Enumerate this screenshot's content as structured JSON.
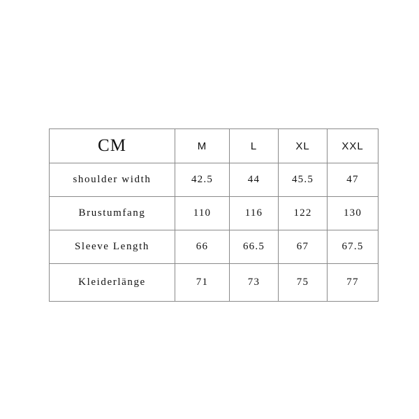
{
  "page": {
    "background_color": "#ffffff",
    "border_color": "#8a8a8a",
    "text_color": "#111111"
  },
  "chart_data": {
    "type": "table",
    "title": "",
    "unit_label": "CM",
    "columns": [
      "CM",
      "M",
      "L",
      "XL",
      "XXL"
    ],
    "size_headers": [
      "M",
      "L",
      "XL",
      "XXL"
    ],
    "rows": [
      {
        "label": "shoulder width",
        "values": [
          "42.5",
          "44",
          "45.5",
          "47"
        ]
      },
      {
        "label": "Brustumfang",
        "values": [
          "110",
          "116",
          "122",
          "130"
        ]
      },
      {
        "label": "Sleeve Length",
        "values": [
          "66",
          "66.5",
          "67",
          "67.5"
        ]
      },
      {
        "label": "Kleiderlänge",
        "values": [
          "71",
          "73",
          "75",
          "77"
        ]
      }
    ]
  }
}
